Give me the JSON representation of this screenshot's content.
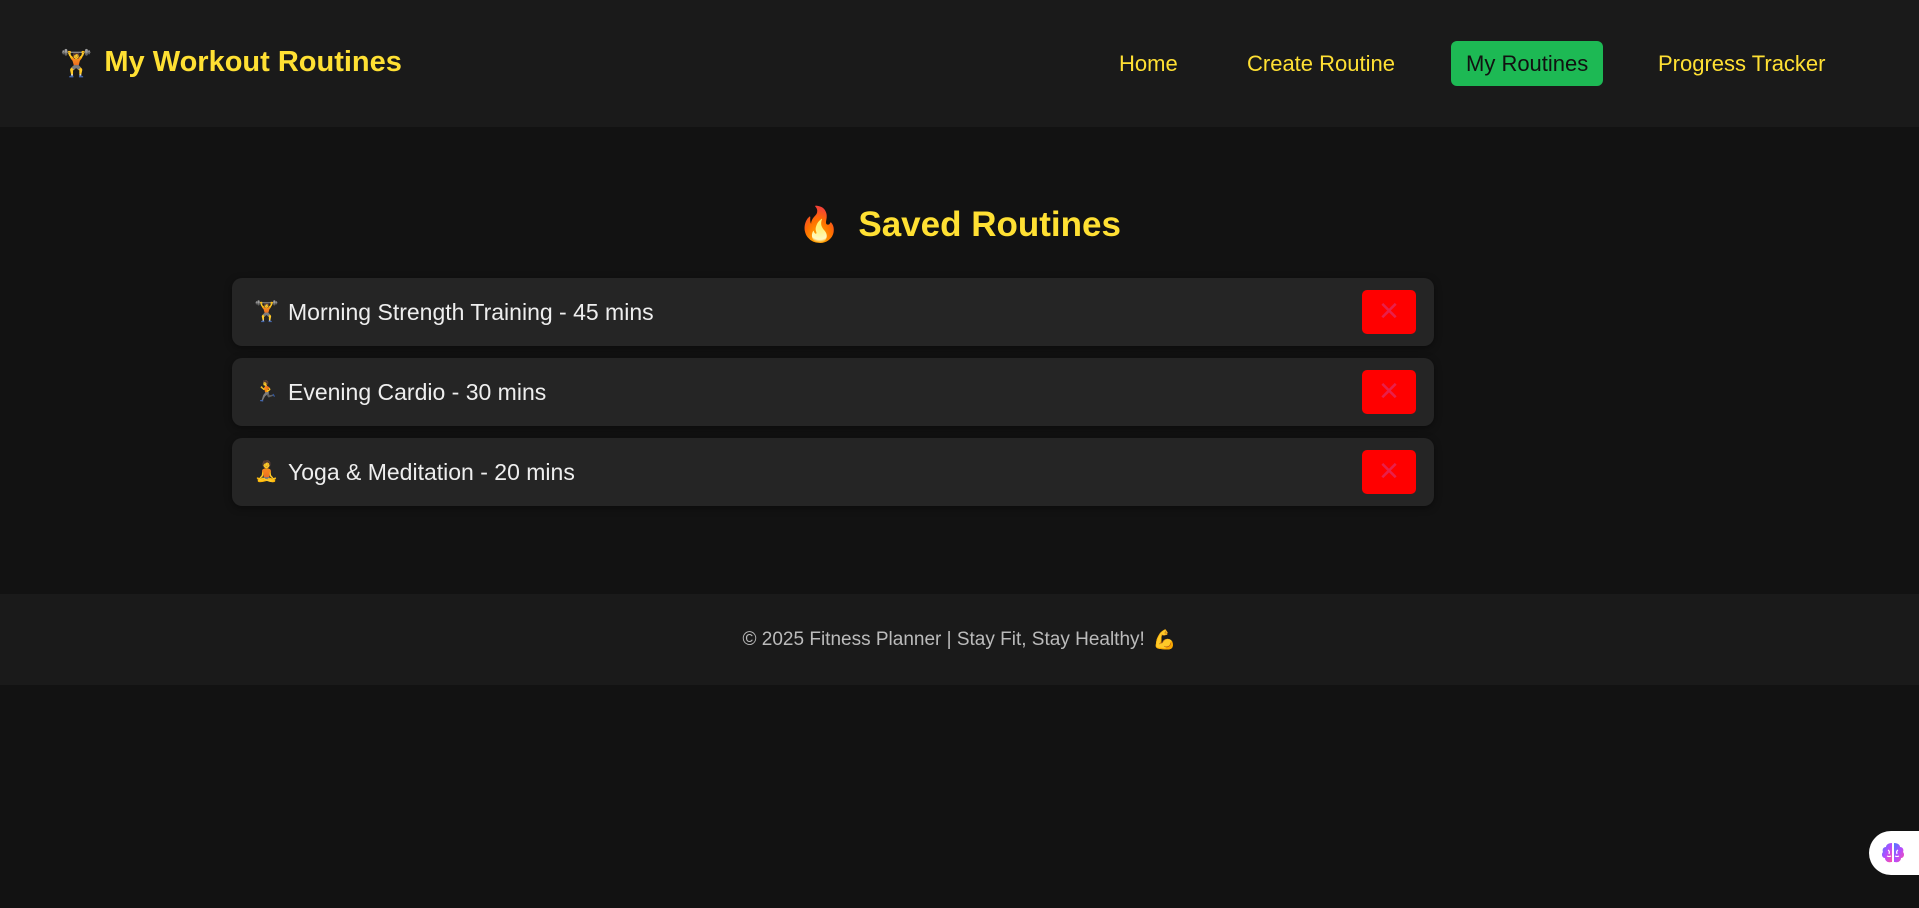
{
  "header": {
    "logo_emoji": "🏋",
    "title": "My Workout Routines",
    "nav": [
      {
        "label": "Home"
      },
      {
        "label": "Create Routine"
      },
      {
        "label": "My Routines",
        "active": true
      },
      {
        "label": "Progress Tracker"
      }
    ]
  },
  "main": {
    "title_emoji": "🔥",
    "title": "Saved Routines",
    "routines": [
      {
        "emoji": "🏋",
        "label": "Morning Strength Training - 45 mins",
        "delete_label": "✕"
      },
      {
        "emoji": "🏃",
        "label": "Evening Cardio - 30 mins",
        "delete_label": "✕"
      },
      {
        "emoji": "🧘",
        "label": "Yoga & Meditation - 20 mins",
        "delete_label": "✕"
      }
    ]
  },
  "footer": {
    "text": "© 2025 Fitness Planner | Stay Fit, Stay Healthy!",
    "emoji": "💪"
  },
  "assistant": {
    "icon": "brain-icon"
  },
  "colors": {
    "accent": "#ffe033",
    "active_nav": "#1db954",
    "delete": "#ff0000",
    "background": "#121212",
    "panel": "#1a1a1a",
    "card": "#252525"
  }
}
